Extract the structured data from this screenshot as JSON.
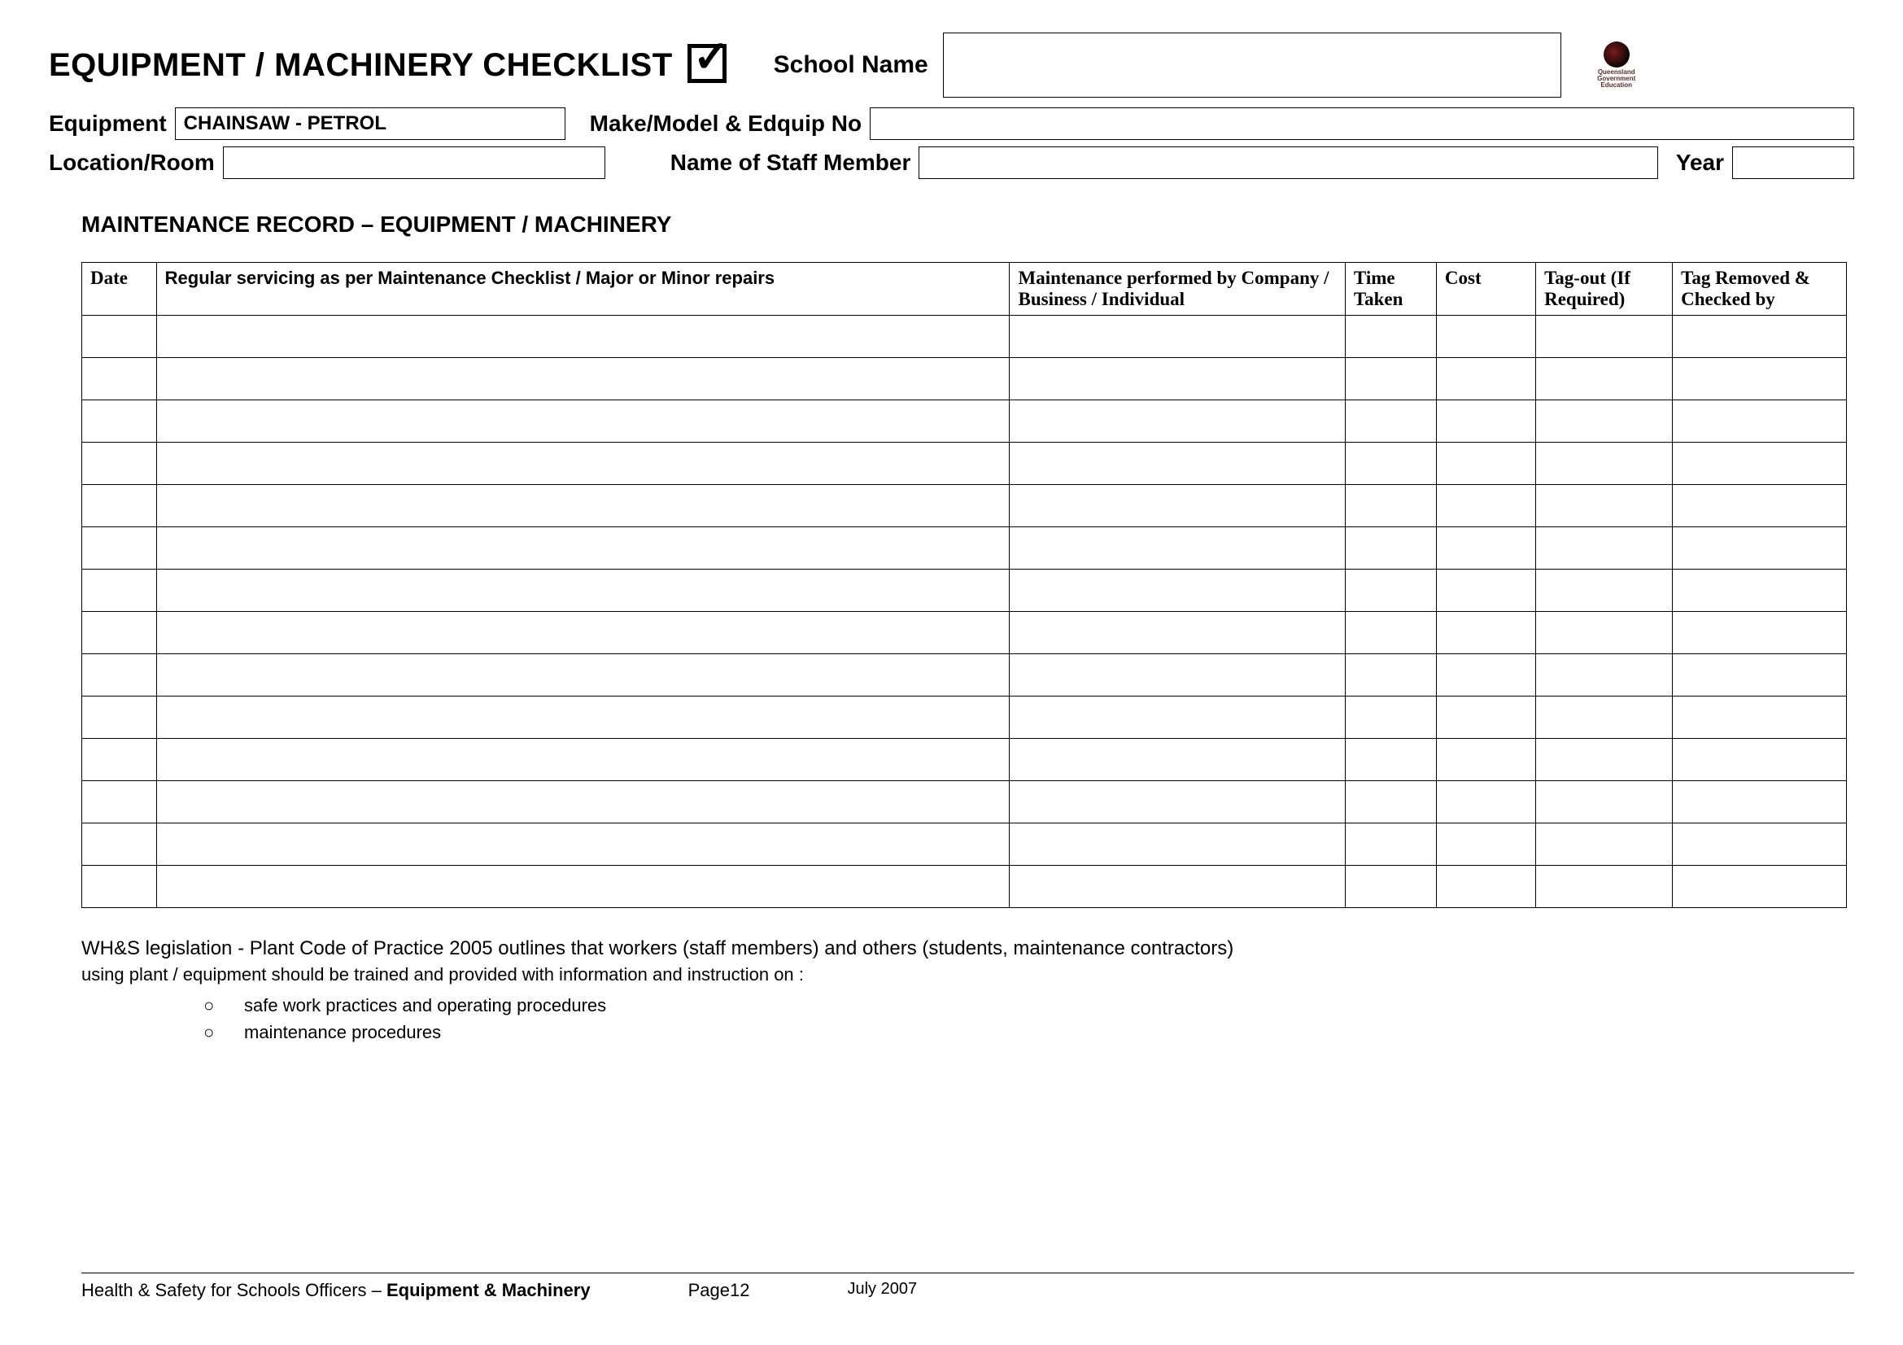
{
  "header": {
    "title": "EQUIPMENT / MACHINERY CHECKLIST",
    "school_label": "School Name",
    "school_value": "",
    "logo_text": "Queensland Government Education"
  },
  "fields": {
    "equipment_label": "Equipment",
    "equipment_value": "CHAINSAW -  PETROL",
    "make_label": "Make/Model & Edquip No",
    "make_value": "",
    "location_label": "Location/Room",
    "location_value": "",
    "staff_label": "Name of Staff Member",
    "staff_value": "",
    "year_label": "Year",
    "year_value": ""
  },
  "section_title": "MAINTENANCE RECORD – EQUIPMENT / MACHINERY",
  "table": {
    "headers": {
      "date": "Date",
      "desc": "Regular servicing as per Maintenance Checklist / Major or Minor repairs",
      "perf": "Maintenance performed by Company / Business / Individual",
      "time": "Time Taken",
      "cost": "Cost",
      "tagout": "Tag-out (If Required)",
      "removed": "Tag Removed & Checked by"
    },
    "row_count": 14
  },
  "notes": {
    "line1": "WH&S legislation - Plant Code of Practice 2005 outlines that workers (staff members) and others (students, maintenance contractors)",
    "line2": "using plant / equipment should be trained and provided with information and instruction on :",
    "bullets": [
      "safe work practices and operating procedures",
      "maintenance procedures"
    ]
  },
  "footer": {
    "left_plain": "Health & Safety for Schools Officers – ",
    "left_bold": "Equipment & Machinery",
    "page": "Page12",
    "date": "July 2007"
  }
}
